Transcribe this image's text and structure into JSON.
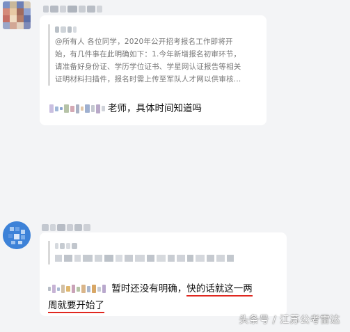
{
  "message1": {
    "quote_lines": "@所有人 各位同学，2020年公开招考报名工作即将开\n始，有几件事在此明确如下：1.今年新增报名初审环节，\n请准备好身份证、学历学位证书、学星网认证报告等相关\n证明材料扫描件，报名时需上传至军队人才网以供审核...",
    "reply_text": "老师，具体时间知道吗"
  },
  "message2": {
    "reply_plain": "暂时还没有明确，",
    "reply_underlined_1": "快的话就这一两",
    "reply_underlined_2": "周就要开始了"
  },
  "watermark": "头条号 / 江苏公考雷达",
  "colors": {
    "underline": "#e0271f",
    "background": "#f3f4f6"
  },
  "icons": [
    "avatar-pixelated",
    "avatar-blue"
  ]
}
